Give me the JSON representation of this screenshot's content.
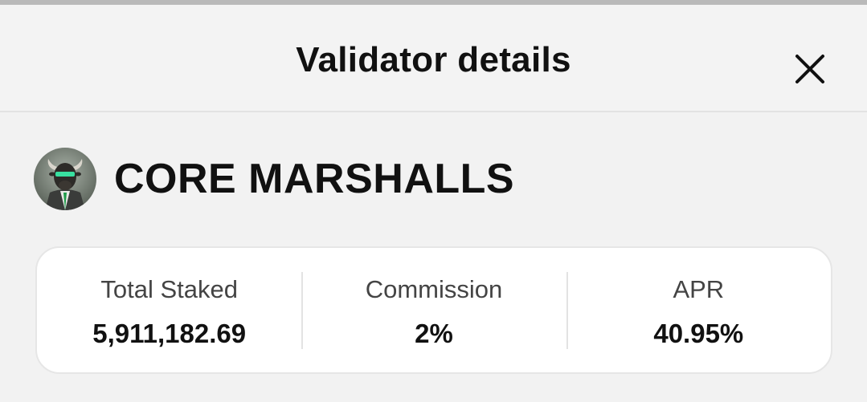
{
  "header": {
    "title": "Validator details",
    "close_icon": "close-icon"
  },
  "validator": {
    "name": "CORE MARSHALLS",
    "avatar_icon": "validator-avatar"
  },
  "stats": [
    {
      "label": "Total Staked",
      "value": "5,911,182.69"
    },
    {
      "label": "Commission",
      "value": "2%"
    },
    {
      "label": "APR",
      "value": "40.95%"
    }
  ],
  "colors": {
    "background": "#f2f2f2",
    "card": "#ffffff",
    "text": "#111111",
    "label": "#444444"
  }
}
